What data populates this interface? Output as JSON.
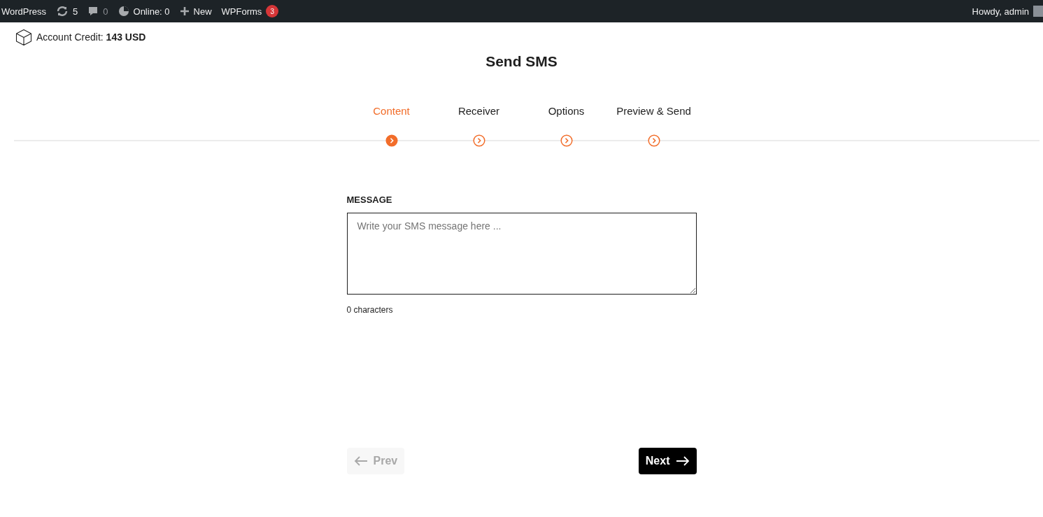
{
  "admin_bar": {
    "items": [
      {
        "kind": "brand",
        "label": "WordPress"
      },
      {
        "kind": "updates",
        "label": "5"
      },
      {
        "kind": "comments",
        "label": "0",
        "disabled": true
      },
      {
        "kind": "online",
        "label": "Online: 0"
      },
      {
        "kind": "new",
        "label": "New"
      },
      {
        "kind": "forms",
        "label": "WPForms",
        "badge": "3"
      }
    ],
    "account": {
      "greeting": "Howdy, admin"
    }
  },
  "credit": {
    "label": "Account Credit:",
    "value": "143 USD"
  },
  "title": "Send SMS",
  "steps": [
    {
      "label": "Content",
      "selected": true
    },
    {
      "label": "Receiver",
      "selected": false
    },
    {
      "label": "Options",
      "selected": false
    },
    {
      "label": "Preview & Send",
      "selected": false
    }
  ],
  "message": {
    "label": "MESSAGE",
    "placeholder": "Write your SMS message here ...",
    "counter": "0 characters"
  },
  "buttons": {
    "prev": {
      "label": "Prev",
      "disabled": true
    },
    "next": {
      "label": "Next",
      "disabled": false
    }
  }
}
